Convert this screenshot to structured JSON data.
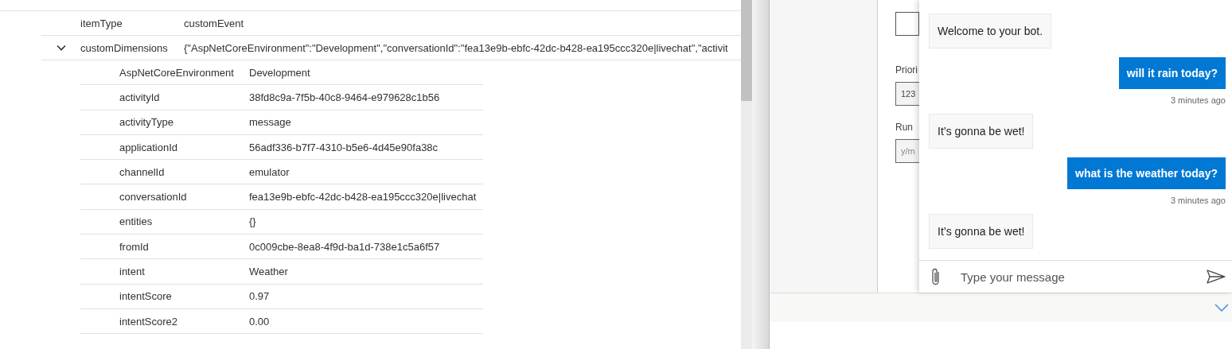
{
  "details": {
    "rows": [
      {
        "kind": "plain",
        "key": "itemType",
        "value": "customEvent"
      },
      {
        "kind": "group",
        "key": "customDimensions",
        "value": "{\"AspNetCoreEnvironment\":\"Development\",\"conversationId\":\"fea13e9b-ebfc-42dc-b428-ea195ccc320e|livechat\",\"activit",
        "expanded": true,
        "children": [
          {
            "key": "AspNetCoreEnvironment",
            "value": "Development"
          },
          {
            "key": "activityId",
            "value": "38fd8c9a-7f5b-40c8-9464-e979628c1b56"
          },
          {
            "key": "activityType",
            "value": "message"
          },
          {
            "key": "applicationId",
            "value": "56adf336-b7f7-4310-b5e6-4d45e90fa38c"
          },
          {
            "key": "channelId",
            "value": "emulator"
          },
          {
            "key": "conversationId",
            "value": "fea13e9b-ebfc-42dc-b428-ea195ccc320e|livechat"
          },
          {
            "key": "entities",
            "value": "{}"
          },
          {
            "key": "fromId",
            "value": "0c009cbe-8ea8-4f9d-ba1d-738e1c5a6f57"
          },
          {
            "key": "intent",
            "value": "Weather"
          },
          {
            "key": "intentScore",
            "value": "0.97"
          },
          {
            "key": "intentScore2",
            "value": "0.00"
          }
        ]
      }
    ]
  },
  "form": {
    "fields": [
      {
        "kind": "box"
      },
      {
        "kind": "input",
        "label": "Priori",
        "value": "123"
      },
      {
        "kind": "input",
        "label": "Run",
        "placeholder": "y/m"
      }
    ]
  },
  "chat": {
    "messages": [
      {
        "kind": "bot",
        "text": "Welcome to your bot."
      },
      {
        "kind": "user",
        "text": "will it rain today?",
        "timestamp": "3 minutes ago"
      },
      {
        "kind": "bot",
        "text": "It’s gonna be wet!"
      },
      {
        "kind": "user",
        "text": "what is the weather today?",
        "timestamp": "3 minutes ago"
      },
      {
        "kind": "bot",
        "text": "It’s gonna be wet!"
      }
    ],
    "input": {
      "placeholder": "Type your message"
    }
  }
}
